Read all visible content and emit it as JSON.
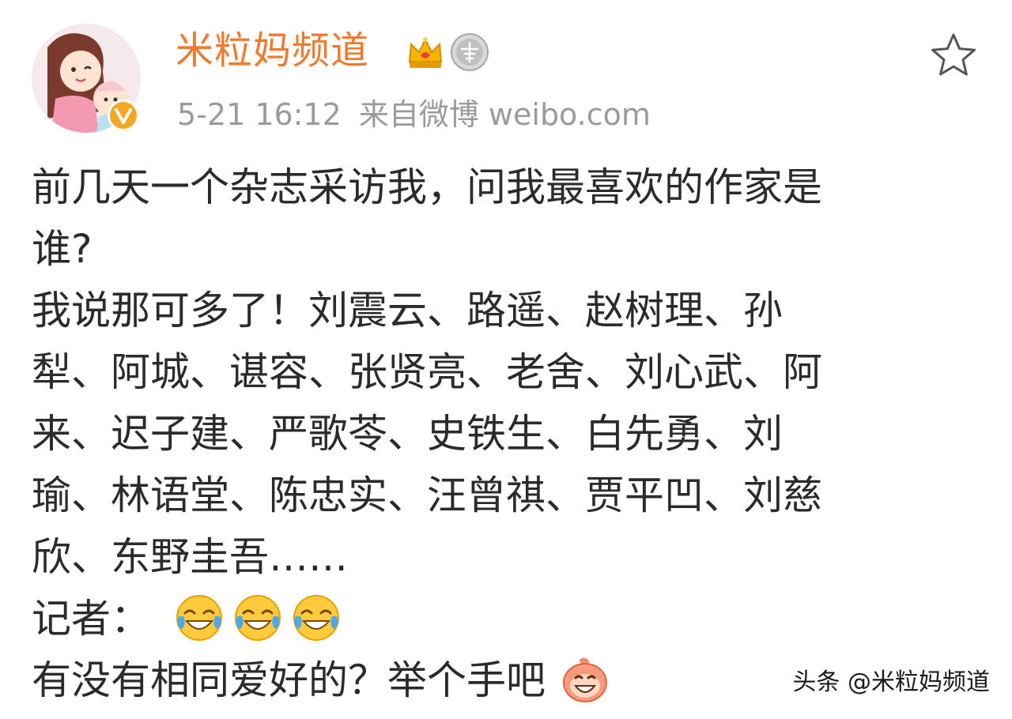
{
  "header": {
    "username": "米粒妈频道",
    "timestamp": "5-21 16:12",
    "source": "来自微博 weibo.com",
    "badges": [
      "crown-badge",
      "medal-badge"
    ],
    "avatar_icon": "avatar-cartoon-mother-baby",
    "verified_icon": "verified-v-icon",
    "favorite_icon": "star-outline-icon"
  },
  "post": {
    "lines": [
      "前几天一个杂志采访我，问我最喜欢的作家是",
      "谁?",
      "我说那可多了！刘震云、路遥、赵树理、孙",
      "犁、阿城、谌容、张贤亮、老舍、刘心武、阿",
      "来、迟子建、严歌苓、史铁生、白先勇、刘",
      "瑜、林语堂、陈忠实、汪曾祺、贾平凹、刘慈",
      "欣、东野圭吾……",
      "记者：",
      "有没有相同爱好的？举个手吧"
    ],
    "reporter_emojis": [
      "laugh-cry-emoji",
      "laugh-cry-emoji",
      "laugh-cry-emoji"
    ],
    "closing_emoji": "grin-emoji"
  },
  "watermark": "头条 @米粒妈频道",
  "colors": {
    "username": "#ee7a2f",
    "meta": "#9b9b9b",
    "text": "#2b2b2b",
    "verified": "#f5a623"
  }
}
